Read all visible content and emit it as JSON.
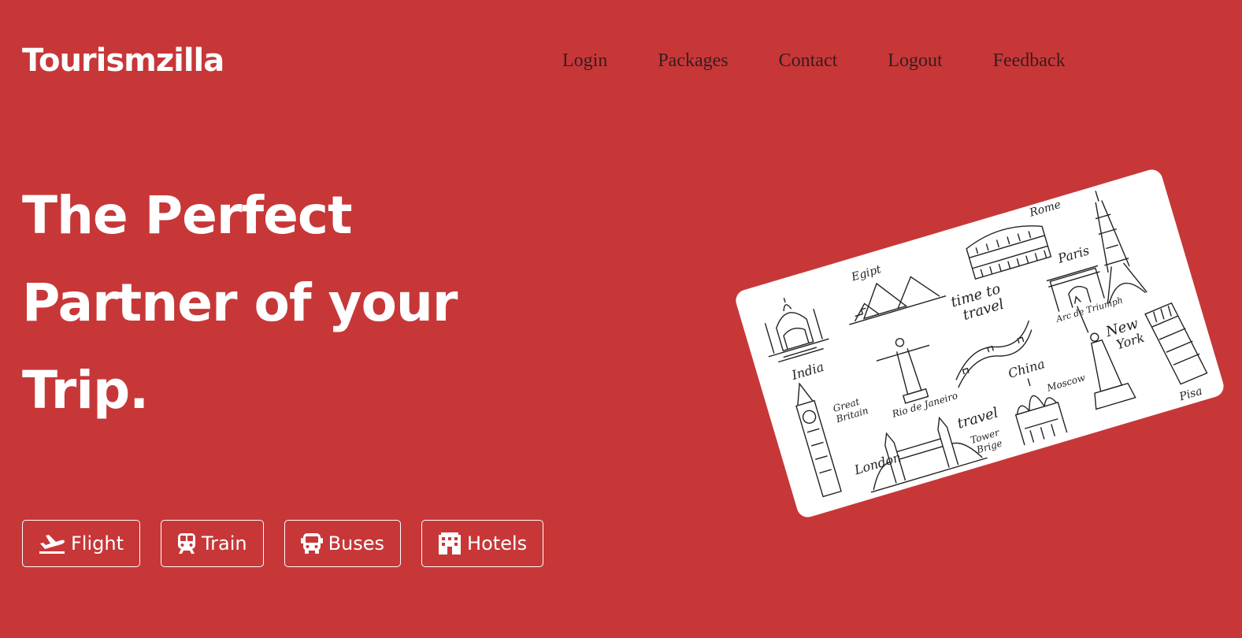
{
  "brand": {
    "logo_text": "Tourismzilla"
  },
  "nav": {
    "items": [
      {
        "label": "Login"
      },
      {
        "label": "Packages"
      },
      {
        "label": "Contact"
      },
      {
        "label": "Logout"
      },
      {
        "label": "Feedback"
      }
    ]
  },
  "hero": {
    "line1": "The Perfect",
    "line2": "Partner of your",
    "line3": "Trip."
  },
  "services": [
    {
      "label": "Flight",
      "icon": "plane-departure-icon"
    },
    {
      "label": "Train",
      "icon": "train-icon"
    },
    {
      "label": "Buses",
      "icon": "bus-icon"
    },
    {
      "label": "Hotels",
      "icon": "hotel-icon"
    }
  ],
  "illustration": {
    "labels": {
      "india": "India",
      "egypt": "Egipt",
      "rome": "Rome",
      "paris": "Paris",
      "time_to": "time to",
      "travel_a": "travel",
      "arc": "Arc de Triumph",
      "great": "Great",
      "britain": "Britain",
      "rio": "Rio de Janeiro",
      "china": "China",
      "new": "New",
      "york": "York",
      "moscow": "Moscow",
      "london": "London",
      "travel_b": "travel",
      "tower": "Tower",
      "bridge": "Brige",
      "pisa": "Pisa"
    }
  },
  "colors": {
    "background": "#c73738",
    "nav_text": "#3a1b1b",
    "foreground": "#ffffff"
  }
}
